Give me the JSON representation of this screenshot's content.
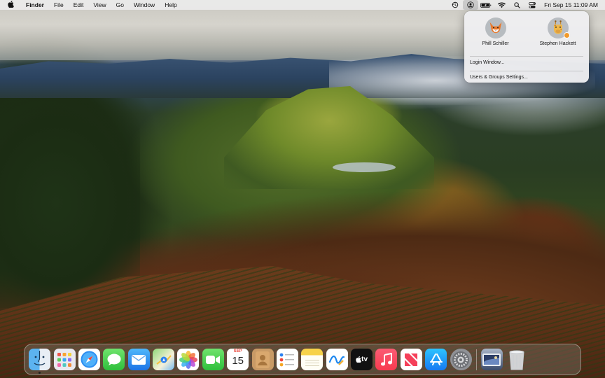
{
  "menubar": {
    "apple_icon": "apple-logo",
    "app_name": "Finder",
    "menus": [
      "File",
      "Edit",
      "View",
      "Go",
      "Window",
      "Help"
    ],
    "status_icons": [
      "time-machine-icon",
      "user-switcher-icon",
      "battery-icon",
      "wifi-icon",
      "search-icon",
      "control-center-icon"
    ],
    "clock": "Fri Sep 15  11:09 AM"
  },
  "user_switcher": {
    "users": [
      {
        "name": "Phill Schiller",
        "avatar": "fox-avatar"
      },
      {
        "name": "Stephen Hackett",
        "avatar": "giraffe-avatar"
      }
    ],
    "login_window_label": "Login Window...",
    "users_groups_label": "Users & Groups Settings..."
  },
  "dock": {
    "apps": [
      {
        "name": "Finder",
        "icon": "finder-icon",
        "running": true
      },
      {
        "name": "Launchpad",
        "icon": "launchpad-icon",
        "running": false
      },
      {
        "name": "Safari",
        "icon": "safari-icon",
        "running": false
      },
      {
        "name": "Messages",
        "icon": "messages-icon",
        "running": false
      },
      {
        "name": "Mail",
        "icon": "mail-icon",
        "running": false
      },
      {
        "name": "Maps",
        "icon": "maps-icon",
        "running": false
      },
      {
        "name": "Photos",
        "icon": "photos-icon",
        "running": false
      },
      {
        "name": "FaceTime",
        "icon": "facetime-icon",
        "running": false
      },
      {
        "name": "Calendar",
        "icon": "calendar-icon",
        "running": false
      },
      {
        "name": "Contacts",
        "icon": "contacts-icon",
        "running": false
      },
      {
        "name": "Reminders",
        "icon": "reminders-icon",
        "running": false
      },
      {
        "name": "Notes",
        "icon": "notes-icon",
        "running": false
      },
      {
        "name": "Freeform",
        "icon": "freeform-icon",
        "running": false
      },
      {
        "name": "TV",
        "icon": "apple-tv-icon",
        "running": false
      },
      {
        "name": "Music",
        "icon": "music-icon",
        "running": false
      },
      {
        "name": "News",
        "icon": "news-icon",
        "running": false
      },
      {
        "name": "App Store",
        "icon": "app-store-icon",
        "running": false
      },
      {
        "name": "System Settings",
        "icon": "settings-icon",
        "running": false
      }
    ],
    "calendar_month": "SEP",
    "calendar_day": "15",
    "tv_label": "tv",
    "recent": [
      {
        "name": "Preview",
        "icon": "preview-icon"
      }
    ],
    "trash": {
      "name": "Trash",
      "icon": "trash-icon"
    }
  }
}
